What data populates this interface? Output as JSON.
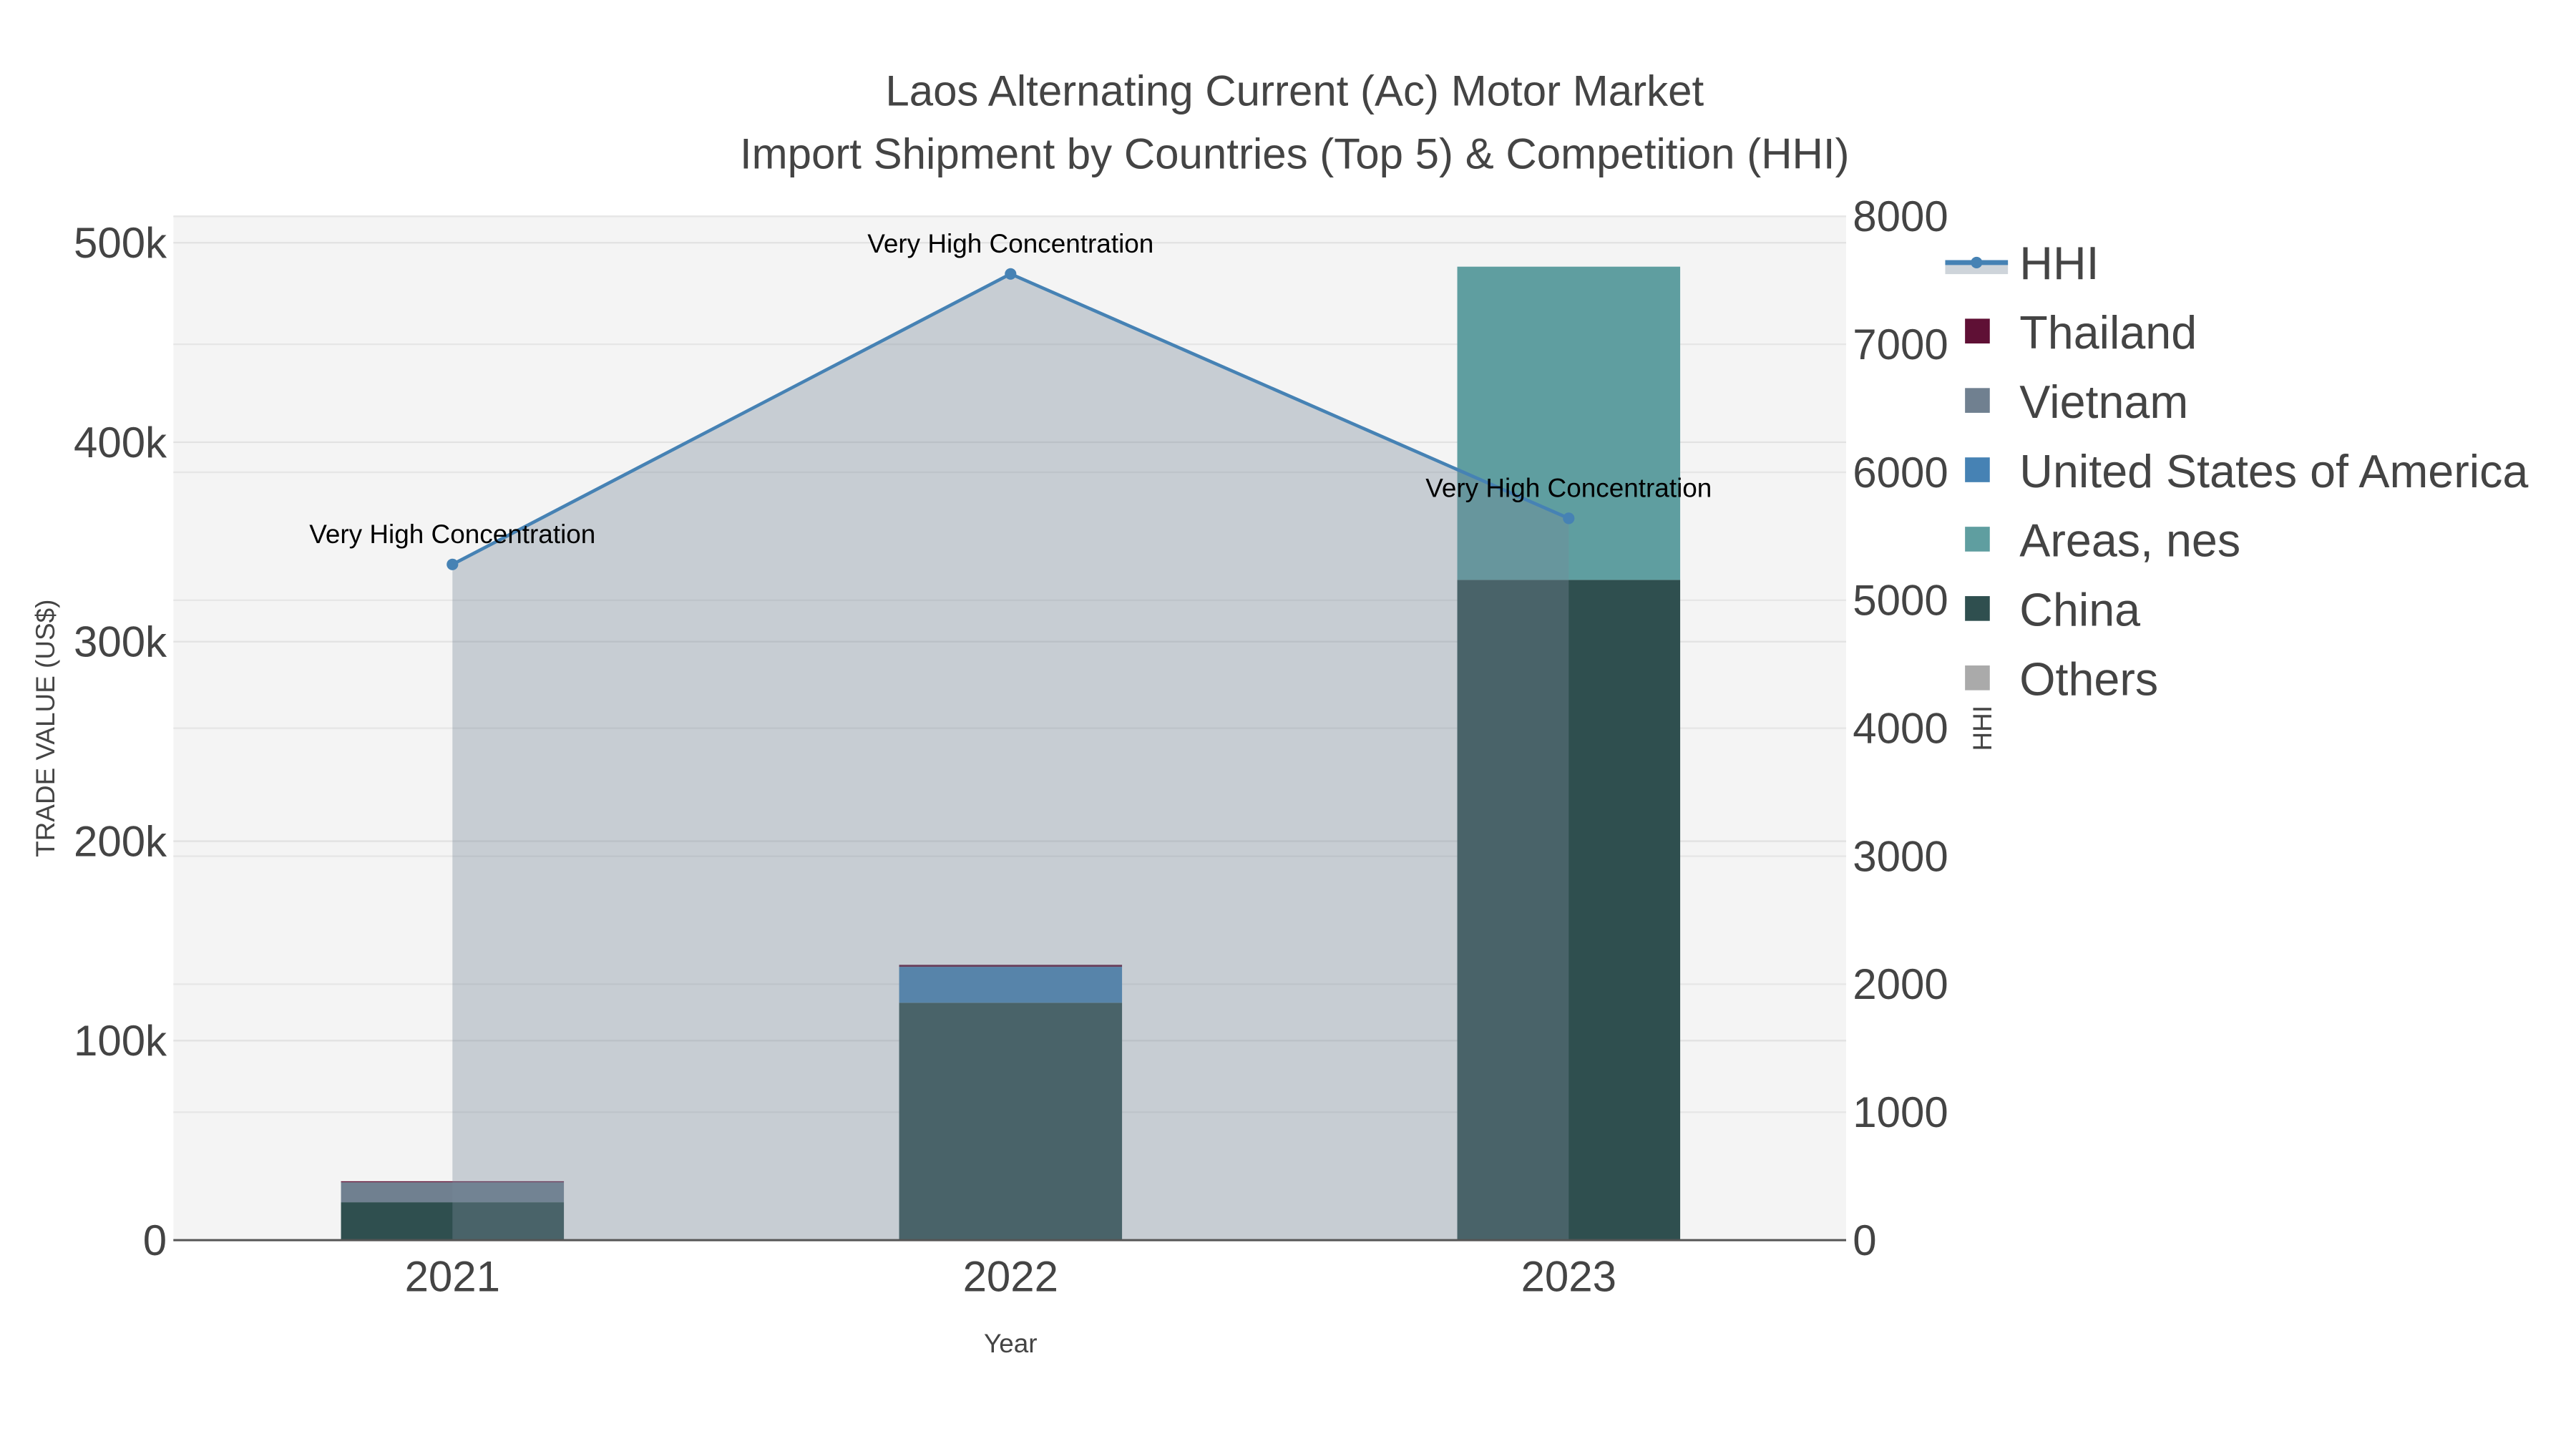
{
  "chart_data": {
    "type": "bar",
    "title": "Laos Alternating Current (Ac) Motor Market",
    "subtitle": "Import Shipment by Countries (Top 5) & Competition (HHI)",
    "xlabel": "Year",
    "ylabel": "TRADE VALUE (US$)",
    "y2label": "HHI",
    "categories": [
      "2021",
      "2022",
      "2023"
    ],
    "ylim": [
      0,
      512000
    ],
    "y2lim": [
      0,
      8000
    ],
    "yticks": [
      0,
      100000,
      200000,
      300000,
      400000,
      500000
    ],
    "ytick_labels": [
      "0",
      "100k",
      "200k",
      "300k",
      "400k",
      "500k"
    ],
    "y2ticks": [
      0,
      1000,
      2000,
      3000,
      4000,
      5000,
      6000,
      7000,
      8000
    ],
    "y2tick_labels": [
      "0",
      "1000",
      "2000",
      "3000",
      "4000",
      "5000",
      "6000",
      "7000",
      "8000"
    ],
    "grid": true,
    "legend_position": "right",
    "stacked": true,
    "series": [
      {
        "name": "China",
        "color": "#2f4f4f",
        "values": [
          19000,
          119000,
          331000
        ]
      },
      {
        "name": "Areas, nes",
        "color": "#5f9ea0",
        "values": [
          0,
          0,
          157000
        ]
      },
      {
        "name": "United States of America",
        "color": "#4682b4",
        "values": [
          0,
          18000,
          0
        ]
      },
      {
        "name": "Vietnam",
        "color": "#708090",
        "values": [
          10000,
          0,
          0
        ]
      },
      {
        "name": "Thailand",
        "color": "#5f1035",
        "values": [
          500,
          1000,
          0
        ]
      },
      {
        "name": "Others",
        "color": "#aaaaaa",
        "values": [
          0,
          0,
          0
        ]
      }
    ],
    "hhi": {
      "name": "HHI",
      "color": "#4682b4",
      "fill": "#778899",
      "values": [
        5280,
        7550,
        5640
      ],
      "annotations": [
        "Very High Concentration",
        "Very High Concentration",
        "Very High Concentration"
      ]
    },
    "legend": [
      "HHI",
      "Thailand",
      "Vietnam",
      "United States of America",
      "Areas, nes",
      "China",
      "Others"
    ]
  }
}
